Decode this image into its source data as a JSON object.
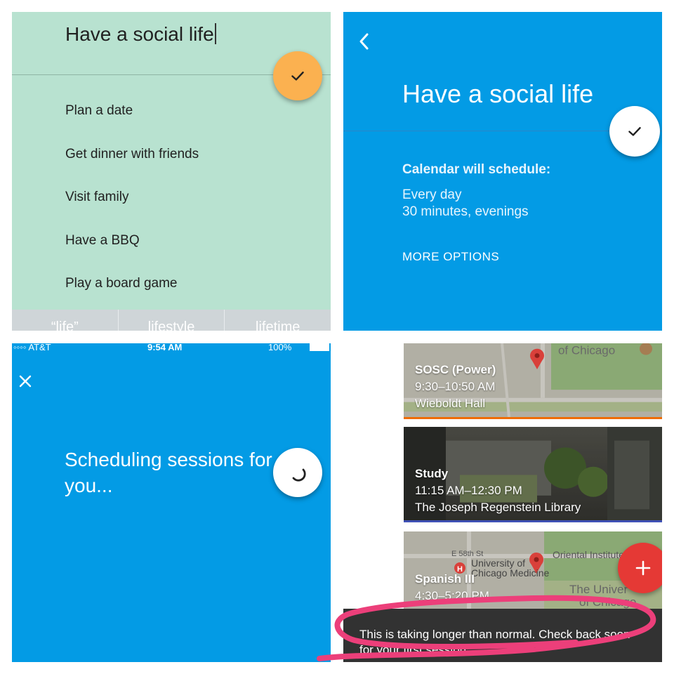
{
  "goal_entry": {
    "input_value": "Have a social life",
    "confirm_icon": "check-icon",
    "suggestions": [
      "Plan a date",
      "Get dinner with friends",
      "Visit family",
      "Have a BBQ",
      "Play a board game"
    ],
    "keyboard_suggestions": [
      "“life”",
      "lifestyle",
      "lifetime"
    ]
  },
  "schedule_detail": {
    "back_icon": "chevron-left-icon",
    "title": "Have a social life",
    "confirm_icon": "check-icon",
    "calendar_label": "Calendar will schedule:",
    "frequency": "Every day",
    "duration": "30 minutes, evenings",
    "more_options": "MORE OPTIONS"
  },
  "scheduling": {
    "status_bar": {
      "carrier": "◦◦◦◦ AT&T",
      "time": "9:54 AM",
      "battery": "100%"
    },
    "close_icon": "close-icon",
    "message": "Scheduling sessions for you...",
    "spinner_icon": "spinner-icon"
  },
  "calendar": {
    "events": [
      {
        "title": "SOSC (Power)",
        "time": "9:30–10:50 AM",
        "location": "Wieboldt Hall"
      },
      {
        "title": "Study",
        "time": "11:15 AM–12:30 PM",
        "location": "The Joseph Regenstein Library"
      },
      {
        "title": "Spanish III",
        "time": "4:30–5:20 PM",
        "location": ""
      }
    ],
    "map_labels": [
      "of Chicago",
      "E 58th St",
      "University of",
      "Chicago Medicine",
      "Oriental Institute",
      "The Univer",
      "of Chicago"
    ],
    "add_icon": "plus-icon",
    "snackbar_text": "This is taking longer than normal. Check back soon for your first session."
  },
  "colors": {
    "mint": "#b8e2d0",
    "blue": "#039be5",
    "orange_fab": "#fbb150",
    "red_fab": "#e53935",
    "snackbar": "#323232",
    "annotation": "#ec3f7a"
  }
}
